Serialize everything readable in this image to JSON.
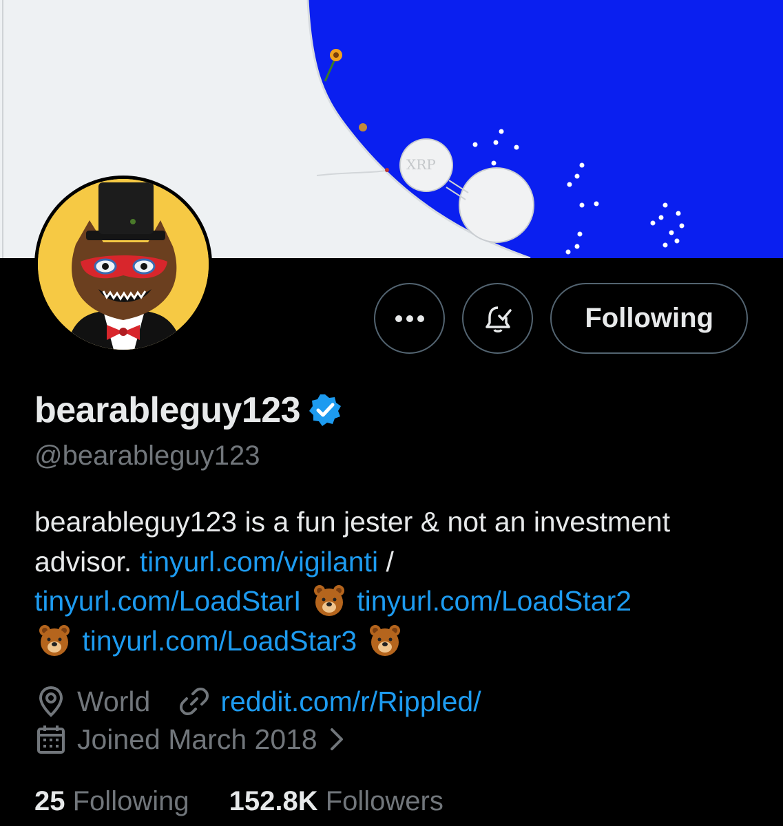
{
  "banner": {
    "coin_label": "XRP",
    "sky_color": "#0a1ff0",
    "snow_color": "#eef1f3"
  },
  "profile": {
    "display_name": "bearableguy123",
    "handle": "@bearableguy123",
    "verified_color": "#1d9bf0"
  },
  "actions": {
    "more_icon": "more-dots-icon",
    "notify_icon": "bell-check-icon",
    "following_label": "Following"
  },
  "bio": {
    "text1": "bearableguy123 is a fun jester & not an investment advisor.",
    "link1": "tinyurl.com/vigilanti",
    "sep": "/",
    "link2": "tinyurl.com/LoadStarI",
    "link3": "tinyurl.com/LoadStar2",
    "link4": "tinyurl.com/LoadStar3",
    "emoji": "bear-face-icon"
  },
  "meta": {
    "location": "World",
    "website": "reddit.com/r/Rippled/",
    "joined": "Joined March 2018"
  },
  "stats": {
    "following_count": "25",
    "following_label": "Following",
    "followers_count": "152.8K",
    "followers_label": "Followers"
  },
  "colors": {
    "link": "#1d9bf0",
    "muted": "#71767b",
    "text": "#e7e9ea",
    "border": "#536471"
  }
}
